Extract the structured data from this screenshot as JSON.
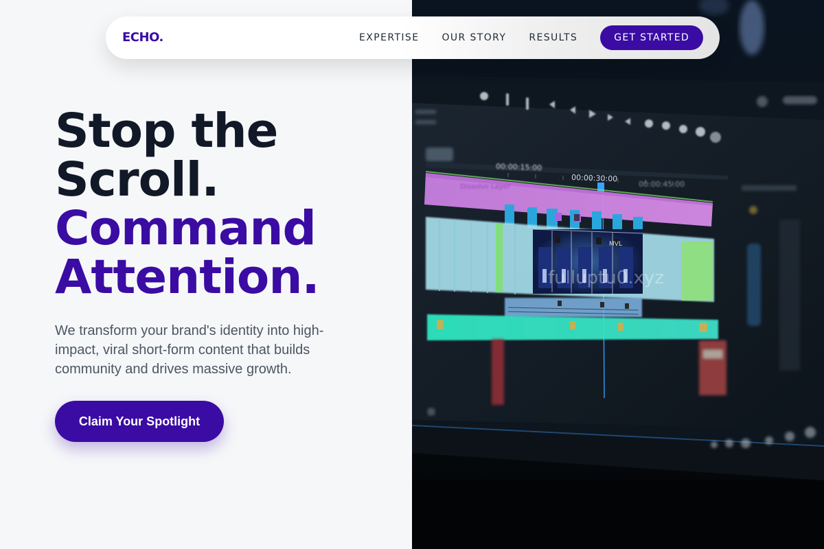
{
  "nav": {
    "logo": "ECHO.",
    "links": [
      "EXPERTISE",
      "OUR STORY",
      "RESULTS"
    ],
    "cta_label": "GET STARTED"
  },
  "hero": {
    "headline_line1": "Stop the",
    "headline_line2": "Scroll.",
    "headline_line3": "Command",
    "headline_line4": "Attention.",
    "subtext": "We transform your brand's identity into high-impact, viral short-form content that builds community and drives massive growth.",
    "cta_label": "Claim Your Spotlight"
  },
  "hero_image": {
    "timecode_1": "00:00:15:00",
    "timecode_2": "00:00:30:00",
    "clip_label": "MVL",
    "watermark": "fulluptu0.xyz"
  },
  "colors": {
    "accent": "#3a0ca3",
    "headline_dark": "#111827",
    "body_text": "#4b5563",
    "page_bg": "#f6f7f9",
    "image_bg": "#05070a"
  },
  "icons": [
    "play-icon",
    "rewind-icon",
    "forward-icon",
    "step-back-icon",
    "step-forward-icon"
  ]
}
